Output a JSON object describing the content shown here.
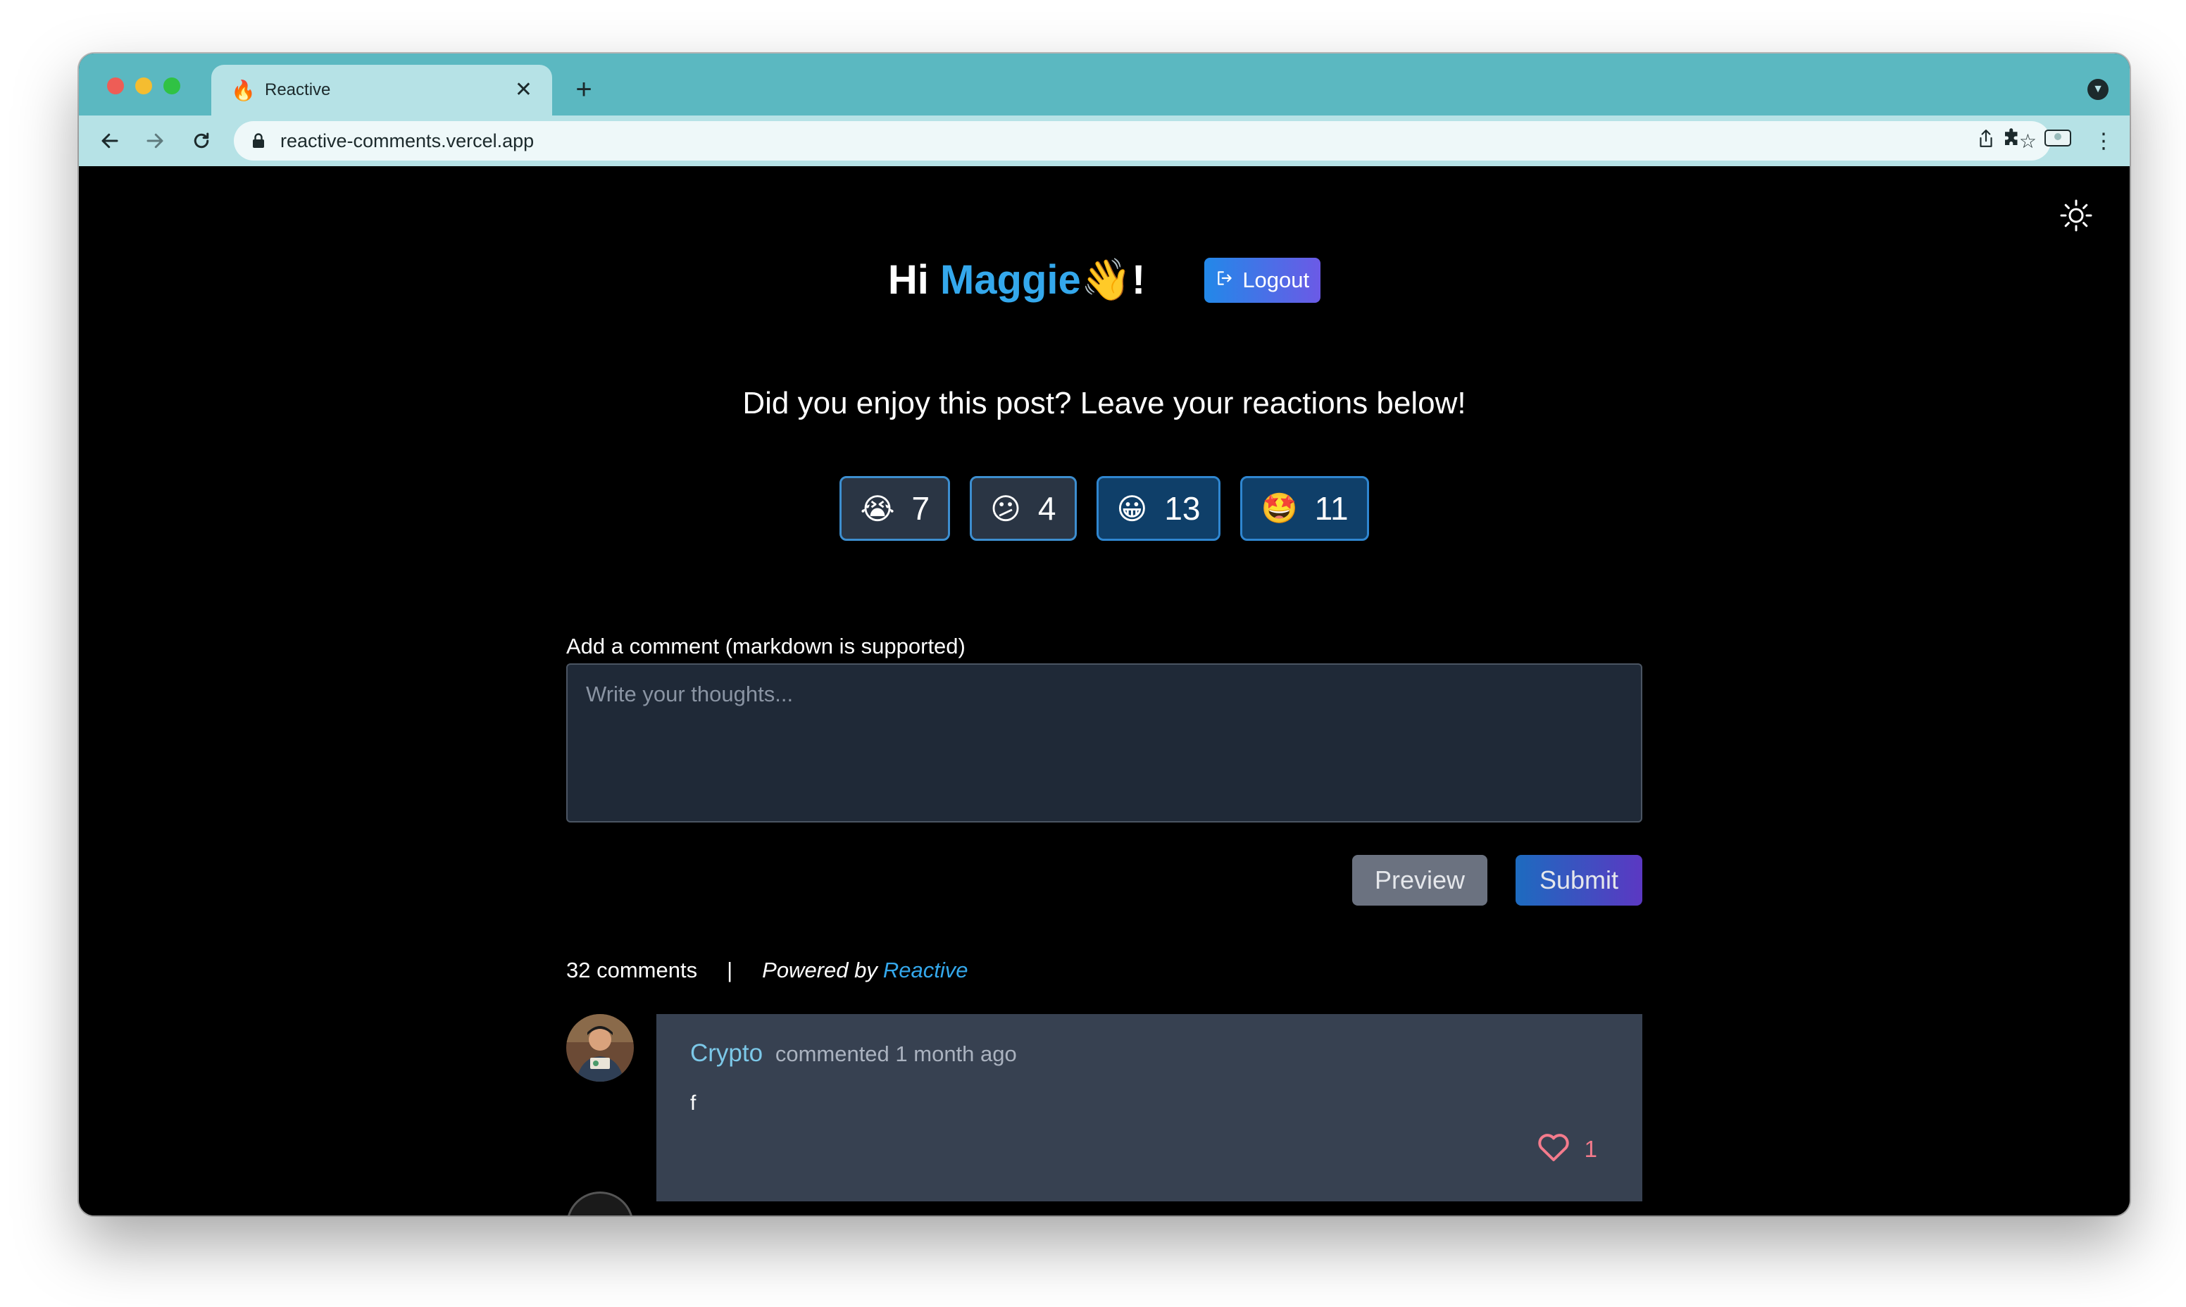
{
  "browser": {
    "tab_title": "Reactive",
    "tab_favicon": "🔥",
    "url": "reactive-comments.vercel.app"
  },
  "page": {
    "greeting_prefix": "Hi",
    "user_name": "Maggie",
    "greeting_suffix": "👋!",
    "logout_label": "Logout",
    "prompt": "Did you enjoy this post? Leave your reactions below!",
    "reactions": [
      {
        "emoji": "😭",
        "count": "7"
      },
      {
        "emoji": "😕",
        "count": "4"
      },
      {
        "emoji": "😀",
        "count": "13"
      },
      {
        "emoji": "🤩",
        "count": "11"
      }
    ],
    "comment_label": "Add a comment (markdown is supported)",
    "comment_placeholder": "Write your thoughts...",
    "preview_label": "Preview",
    "submit_label": "Submit",
    "comment_count": "32 comments",
    "separator": "|",
    "powered_by": "Powered by",
    "brand": "Reactive"
  },
  "comments": [
    {
      "author": "Crypto",
      "when": "commented 1 month ago",
      "body": "f",
      "likes": "1"
    }
  ],
  "colors": {
    "chrome": "#5bb8c1",
    "accent": "#34a8ec",
    "card": "#374151",
    "heart": "#f47b8c"
  }
}
